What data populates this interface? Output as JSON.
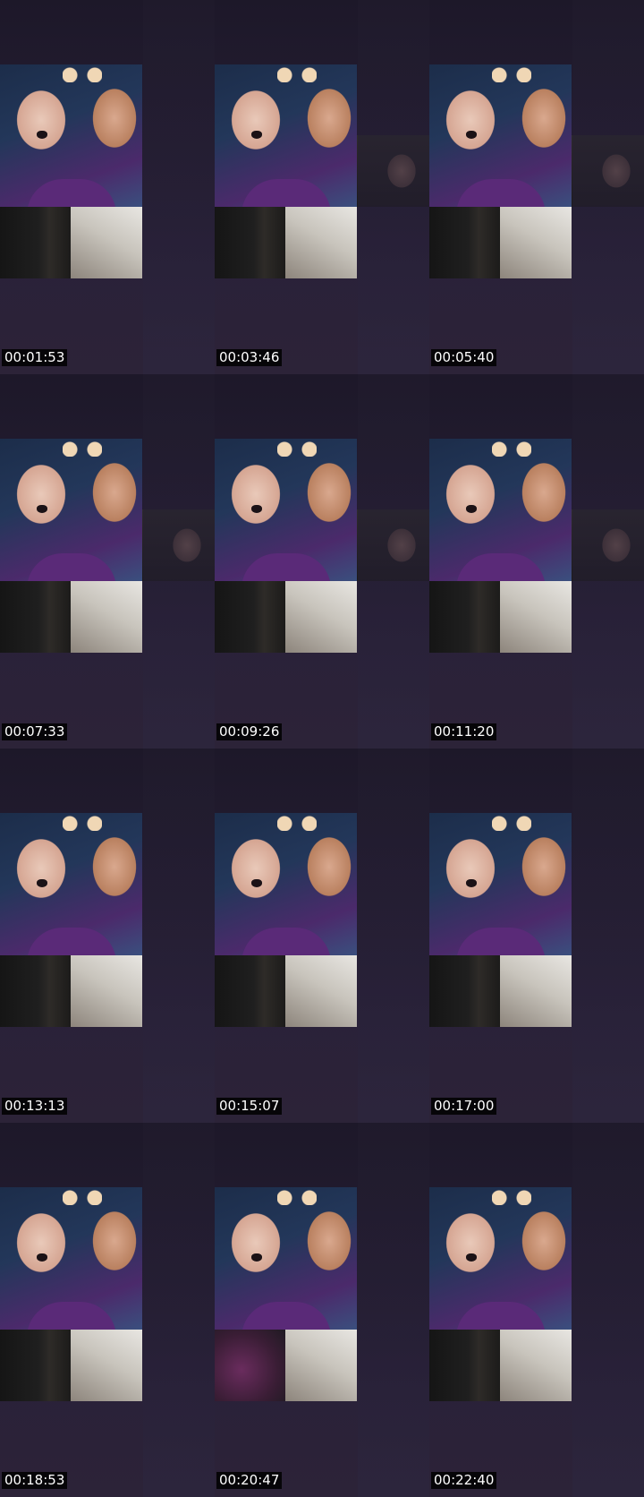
{
  "frames": [
    {
      "timestamp": "00:01:53",
      "side_participant": false
    },
    {
      "timestamp": "00:03:46",
      "side_participant": true
    },
    {
      "timestamp": "00:05:40",
      "side_participant": true
    },
    {
      "timestamp": "00:07:33",
      "side_participant": true
    },
    {
      "timestamp": "00:09:26",
      "side_participant": true
    },
    {
      "timestamp": "00:11:20",
      "side_participant": true
    },
    {
      "timestamp": "00:13:13",
      "side_participant": false
    },
    {
      "timestamp": "00:15:07",
      "side_participant": false
    },
    {
      "timestamp": "00:17:00",
      "side_participant": false
    },
    {
      "timestamp": "00:18:53",
      "side_participant": false
    },
    {
      "timestamp": "00:20:47",
      "side_participant": false
    },
    {
      "timestamp": "00:22:40",
      "side_participant": false
    }
  ],
  "colors": {
    "background": "#1e1a2b",
    "timestamp_bg": "#000000",
    "timestamp_text": "#ffffff"
  }
}
